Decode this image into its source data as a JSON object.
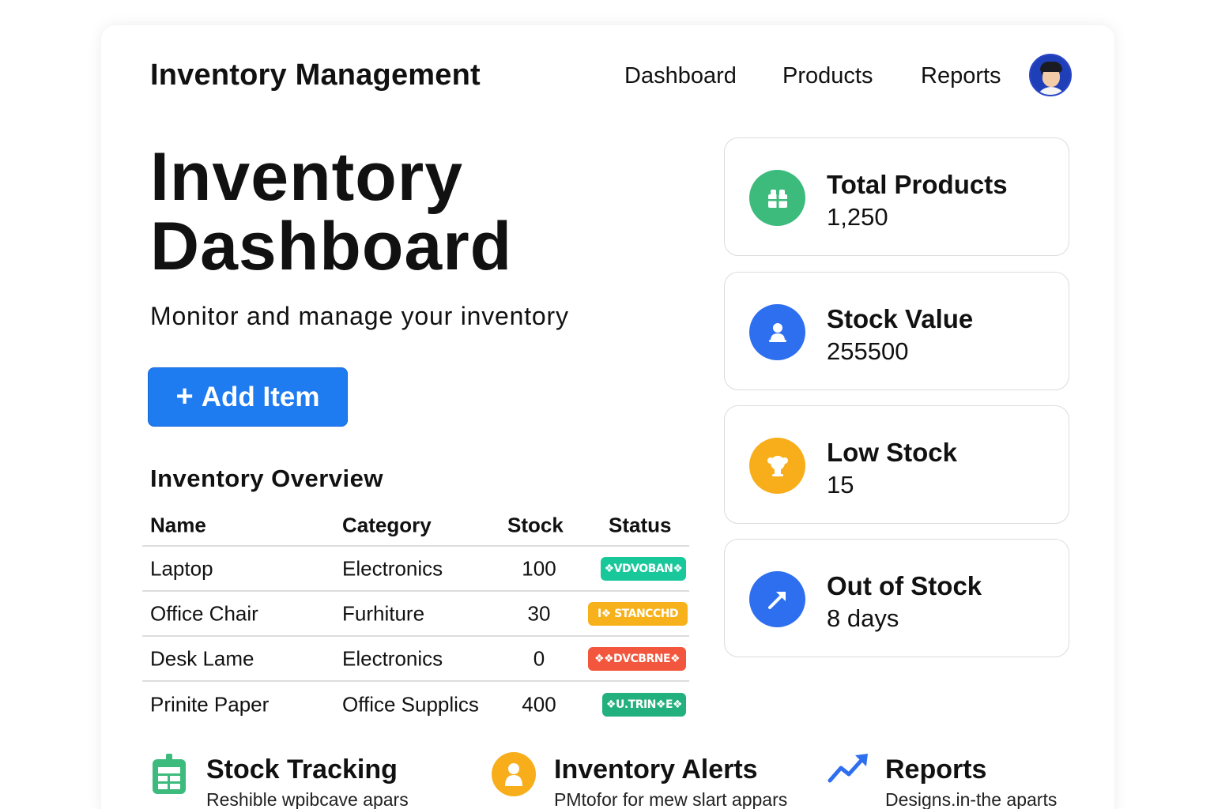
{
  "header": {
    "app_title": "Inventory Management",
    "nav": [
      "Dashboard",
      "Products",
      "Reports"
    ]
  },
  "hero": {
    "title_line1": "Inventory",
    "title_line2": "Dashboard",
    "subtitle": "Monitor and manage your inventory",
    "add_button_label": "Add Item",
    "add_button_icon": "plus-icon"
  },
  "overview": {
    "title": "Inventory Overview",
    "columns": [
      "Name",
      "Category",
      "Stock",
      "Status"
    ],
    "rows": [
      {
        "name": "Laptop",
        "category": "Electronics",
        "stock": "100",
        "status": "❖VDVOBAN❖",
        "status_color": "#19c89a"
      },
      {
        "name": "Office Chair",
        "category": "Furhiture",
        "stock": "30",
        "status": "I❖ STANCCHD",
        "status_color": "#f7b21b"
      },
      {
        "name": "Desk Lame",
        "category": "Electronics",
        "stock": "0",
        "status": "❖❖DVCBRNE❖",
        "status_color": "#f2563c"
      },
      {
        "name": "Prinite Paper",
        "category": "Office Supplics",
        "stock": "400",
        "status": "❖U.TRIN❖E❖",
        "status_color": "#22b07e"
      }
    ]
  },
  "stats": [
    {
      "label": "Total Products",
      "value": "1,250",
      "icon": "gift-icon",
      "color": "#3cbb7c"
    },
    {
      "label": "Stock Value",
      "value": "255500",
      "icon": "user-icon",
      "color": "#2e6ff0"
    },
    {
      "label": "Low Stock",
      "value": "15",
      "icon": "trophy-icon",
      "color": "#f8ae1b"
    },
    {
      "label": "Out of Stock",
      "value": "8 days",
      "icon": "arrow-up-right-icon",
      "color": "#2e6ff0"
    }
  ],
  "features": [
    {
      "title": "Stock Tracking",
      "desc": "Reshible wpibcave apars",
      "icon": "calendar-grid-icon",
      "color": "#3cbb7c"
    },
    {
      "title": "Inventory Alerts",
      "desc": "PMtofor for mew slart appars",
      "icon": "person-icon",
      "color": "#f8ae1b"
    },
    {
      "title": "Reports",
      "desc": "Designs.in-the aparts",
      "icon": "trend-up-icon",
      "color": "#2e6ff0"
    }
  ]
}
